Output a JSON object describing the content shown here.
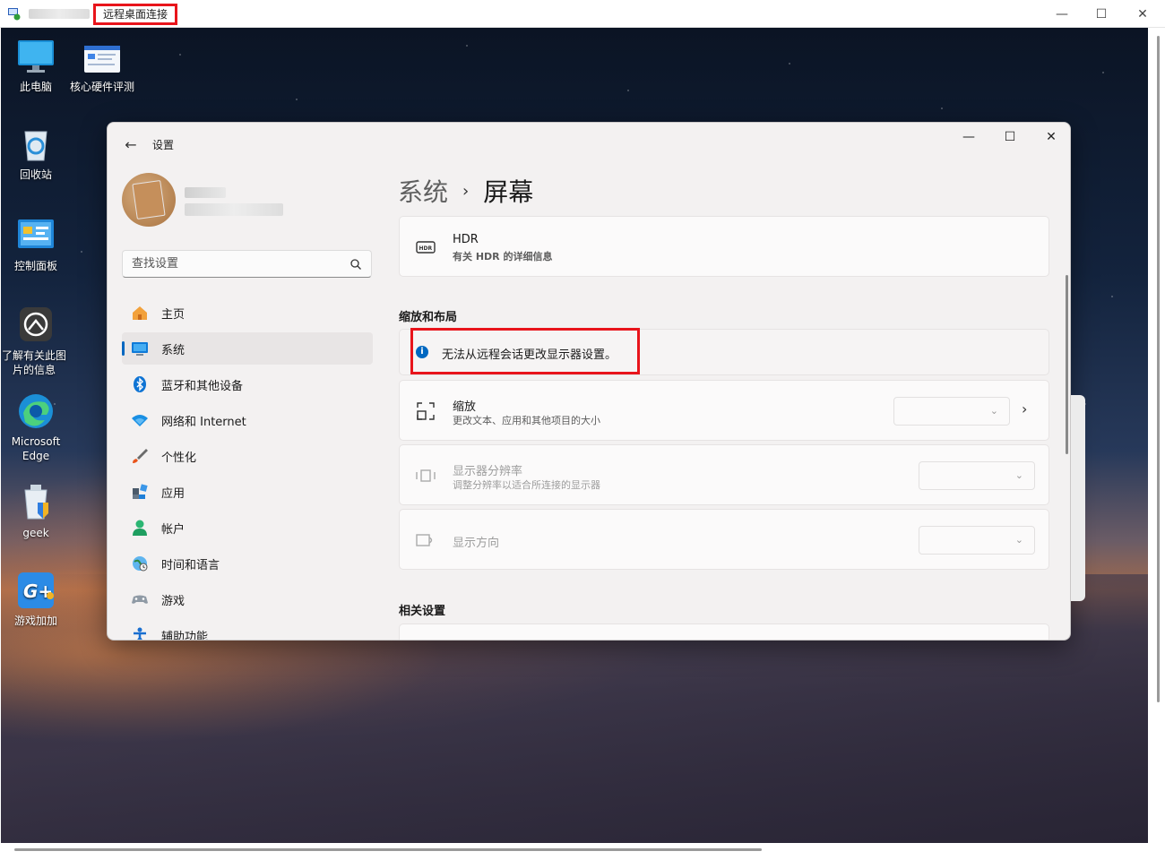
{
  "rdp": {
    "title": "远程桌面连接",
    "controls": {
      "minimize": "—",
      "maximize": "☐",
      "close": "✕"
    }
  },
  "desktop_icons": [
    {
      "label": "此电脑",
      "icon": "monitor-icon"
    },
    {
      "label": "核心硬件评测",
      "icon": "hardware-test-icon"
    },
    {
      "label": "回收站",
      "icon": "recycle-bin-icon"
    },
    {
      "label": "控制面板",
      "icon": "control-panel-icon"
    },
    {
      "label": "了解有关此图片的信息",
      "icon": "picture-info-icon"
    },
    {
      "label": "Microsoft Edge",
      "icon": "edge-icon"
    },
    {
      "label": "geek",
      "icon": "geek-icon"
    },
    {
      "label": "游戏加加",
      "icon": "game-plus-icon"
    }
  ],
  "settings": {
    "app_title": "设置",
    "back_icon": "←",
    "controls": {
      "minimize": "—",
      "maximize": "☐",
      "close": "✕"
    },
    "search_placeholder": "查找设置",
    "nav": [
      {
        "label": "主页",
        "icon": "home-icon",
        "active": false
      },
      {
        "label": "系统",
        "icon": "system-icon",
        "active": true
      },
      {
        "label": "蓝牙和其他设备",
        "icon": "bluetooth-icon",
        "active": false
      },
      {
        "label": "网络和 Internet",
        "icon": "network-icon",
        "active": false
      },
      {
        "label": "个性化",
        "icon": "brush-icon",
        "active": false
      },
      {
        "label": "应用",
        "icon": "apps-icon",
        "active": false
      },
      {
        "label": "帐户",
        "icon": "account-icon",
        "active": false
      },
      {
        "label": "时间和语言",
        "icon": "time-language-icon",
        "active": false
      },
      {
        "label": "游戏",
        "icon": "gaming-icon",
        "active": false
      },
      {
        "label": "辅助功能",
        "icon": "accessibility-icon",
        "active": false
      }
    ],
    "breadcrumb": {
      "parent": "系统",
      "separator": "›",
      "current": "屏幕"
    },
    "hdr": {
      "title": "HDR",
      "link": "有关 HDR 的详细信息",
      "icon_text": "HDR"
    },
    "section_scale": "缩放和布局",
    "info_message": "无法从远程会话更改显示器设置。",
    "scale": {
      "title": "缩放",
      "subtitle": "更改文本、应用和其他项目的大小"
    },
    "resolution": {
      "title": "显示器分辨率",
      "subtitle": "调整分辨率以适合所连接的显示器"
    },
    "orientation": {
      "title": "显示方向"
    },
    "section_related": "相关设置",
    "colors": {
      "accent": "#0067c0",
      "highlight": "#e8141b"
    }
  }
}
